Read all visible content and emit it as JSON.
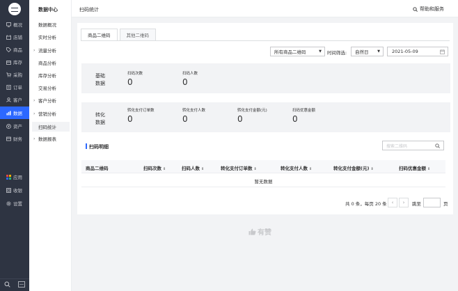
{
  "nav": {
    "items": [
      {
        "label": "概况",
        "icon": "monitor-icon"
      },
      {
        "label": "店铺",
        "icon": "store-icon"
      },
      {
        "label": "商品",
        "icon": "tag-icon"
      },
      {
        "label": "库存",
        "icon": "box-icon"
      },
      {
        "label": "采购",
        "icon": "cart-icon"
      },
      {
        "label": "订单",
        "icon": "order-icon"
      },
      {
        "label": "客户",
        "icon": "user-icon"
      },
      {
        "label": "数据",
        "icon": "chart-icon"
      },
      {
        "label": "资产",
        "icon": "yen-icon"
      },
      {
        "label": "财务",
        "icon": "finance-icon"
      }
    ],
    "bottom_items": [
      {
        "label": "应用",
        "icon": "apps-icon"
      },
      {
        "label": "收银",
        "icon": "cashier-icon"
      },
      {
        "label": "设置",
        "icon": "gear-icon"
      }
    ]
  },
  "subnav": {
    "title": "数据中心",
    "items": [
      {
        "label": "数据概况",
        "chevron": ""
      },
      {
        "label": "实时分析",
        "chevron": ""
      },
      {
        "label": "流量分析",
        "chevron": "›"
      },
      {
        "label": "商品分析",
        "chevron": ""
      },
      {
        "label": "库存分析",
        "chevron": ""
      },
      {
        "label": "交易分析",
        "chevron": ""
      },
      {
        "label": "客户分析",
        "chevron": "›"
      },
      {
        "label": "营销分析",
        "chevron": "›"
      },
      {
        "label": "扫码统计",
        "chevron": ""
      },
      {
        "label": "数据报表",
        "chevron": "›"
      }
    ]
  },
  "header": {
    "title": "扫码统计",
    "help": "帮助和服务"
  },
  "tabs": [
    "商品二维码",
    "其他二维码"
  ],
  "filters": {
    "qr_select": "所有商品二维码",
    "time_label": "时间筛选:",
    "period_select": "自然日",
    "date": "2021-05-09"
  },
  "basic": {
    "label": "基础\n数据",
    "metrics": [
      {
        "name": "扫码次数",
        "value": "0"
      },
      {
        "name": "扫码人数",
        "value": "0"
      }
    ]
  },
  "conversion": {
    "label": "转化\n数据",
    "metrics": [
      {
        "name": "转化支付订单数",
        "value": "0"
      },
      {
        "name": "转化支付人数",
        "value": "0"
      },
      {
        "name": "转化支付金额(元)",
        "value": "0"
      },
      {
        "name": "扫码优惠金额",
        "value": "0"
      }
    ]
  },
  "detail": {
    "title": "扫码明细",
    "search_placeholder": "搜索二维码",
    "columns": [
      "商品二维码",
      "扫码次数",
      "扫码人数",
      "转化支付订单数",
      "转化支付人数",
      "转化支付金额(元)",
      "扫码优惠金额"
    ],
    "empty_text": "暂无数据"
  },
  "pager": {
    "info": "共 0 条，每页 20 条",
    "prev": "‹",
    "next": "›",
    "jump": "跳至",
    "page": "页"
  },
  "footer": {
    "brand": "有赞"
  },
  "colors": {
    "accent": "#2c68ff",
    "nav_bg": "#2e3442"
  }
}
